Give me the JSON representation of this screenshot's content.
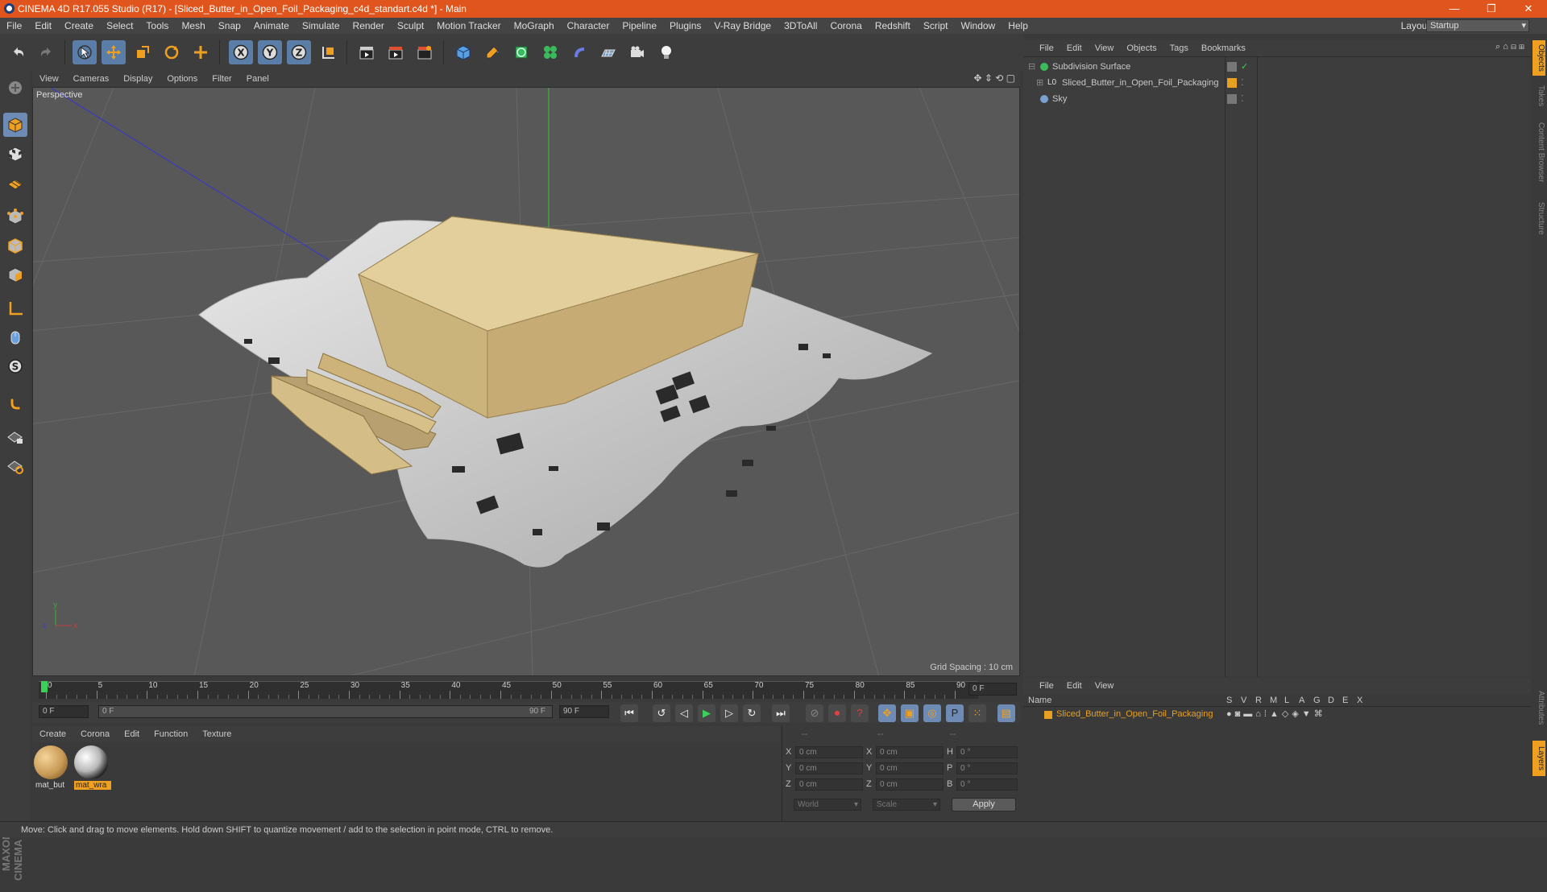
{
  "titlebar": {
    "title": "CINEMA 4D R17.055 Studio (R17) - [Sliced_Butter_in_Open_Foil_Packaging_c4d_standart.c4d *] - Main",
    "min": "—",
    "restore": "❐",
    "close": "✕"
  },
  "menubar": {
    "items": [
      "File",
      "Edit",
      "Create",
      "Select",
      "Tools",
      "Mesh",
      "Snap",
      "Animate",
      "Simulate",
      "Render",
      "Sculpt",
      "Motion Tracker",
      "MoGraph",
      "Character",
      "Pipeline",
      "Plugins",
      "V-Ray Bridge",
      "3DToAll",
      "Corona",
      "Redshift",
      "Script",
      "Window",
      "Help"
    ],
    "layout_label": "Layout:",
    "layout_value": "Startup"
  },
  "viewport": {
    "menu": [
      "View",
      "Cameras",
      "Display",
      "Options",
      "Filter",
      "Panel"
    ],
    "label": "Perspective",
    "grid_spacing": "Grid Spacing : 10 cm"
  },
  "timeline": {
    "ticks": [
      "0",
      "5",
      "10",
      "15",
      "20",
      "25",
      "30",
      "35",
      "40",
      "45",
      "50",
      "55",
      "60",
      "65",
      "70",
      "75",
      "80",
      "85",
      "90"
    ],
    "end_field": "0 F",
    "start_field": "0 F",
    "range_start": "0 F",
    "range_end": "90 F",
    "max_field": "90 F"
  },
  "materials": {
    "menu": [
      "Create",
      "Corona",
      "Edit",
      "Function",
      "Texture"
    ],
    "items": [
      {
        "label": "mat_but",
        "color": "#c89a55"
      },
      {
        "label": "mat_wra",
        "color": "#d8d8d8"
      }
    ]
  },
  "coordinates": {
    "headers": [
      "--",
      "--",
      "--"
    ],
    "rows": [
      {
        "a": "X",
        "av": "0 cm",
        "b": "X",
        "bv": "0 cm",
        "c": "H",
        "cv": "0 °"
      },
      {
        "a": "Y",
        "av": "0 cm",
        "b": "Y",
        "bv": "0 cm",
        "c": "P",
        "cv": "0 °"
      },
      {
        "a": "Z",
        "av": "0 cm",
        "b": "Z",
        "bv": "0 cm",
        "c": "B",
        "cv": "0 °"
      }
    ],
    "world": "World",
    "scale": "Scale",
    "apply": "Apply"
  },
  "objects": {
    "menu": [
      "File",
      "Edit",
      "View",
      "Objects",
      "Tags",
      "Bookmarks"
    ],
    "items": [
      {
        "name": "Subdivision Surface",
        "color": "#c8c8c8"
      },
      {
        "name": "Sliced_Butter_in_Open_Foil_Packaging",
        "color": "#c8c8c8"
      },
      {
        "name": "Sky",
        "color": "#c8c8c8"
      }
    ]
  },
  "layers": {
    "menu": [
      "File",
      "Edit",
      "View"
    ],
    "col_name": "Name",
    "cols": [
      "S",
      "V",
      "R",
      "M",
      "L",
      "A",
      "G",
      "D",
      "E",
      "X"
    ],
    "layer_name": "Sliced_Butter_in_Open_Foil_Packaging",
    "layer_color": "#e8a020"
  },
  "righttabs": [
    "Objects",
    "Takes",
    "Content Browser",
    "Structure",
    "Attributes",
    "Layers"
  ],
  "status": "Move: Click and drag to move elements. Hold down SHIFT to quantize movement / add to the selection in point mode, CTRL to remove.",
  "logo": "MAXON CINEMA 4D"
}
